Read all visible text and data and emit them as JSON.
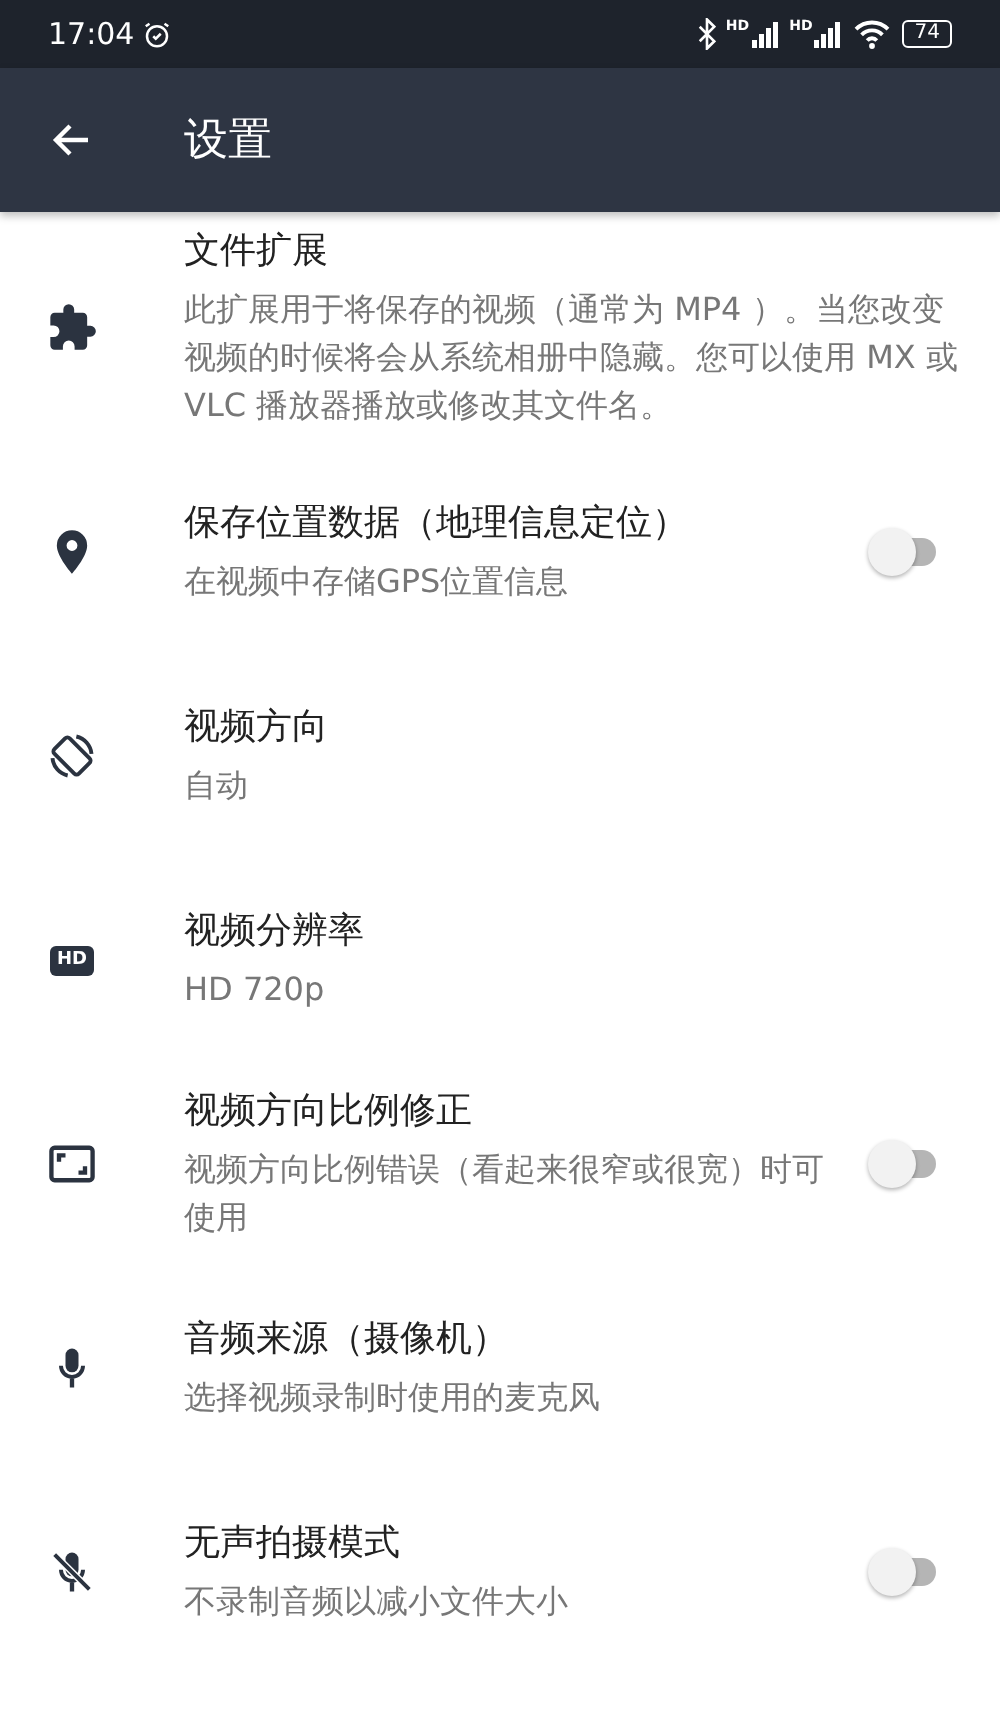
{
  "status_bar": {
    "time": "17:04",
    "network_labels": [
      "HD",
      "HD"
    ],
    "battery": "74"
  },
  "app_bar": {
    "title": "设置"
  },
  "settings": [
    {
      "kind": "plain",
      "title": "文件扩展",
      "description": "此扩展用于将保存的视频（通常为 MP4 ）。当您改变视频的时候将会从系统相册中隐藏。您可以使用 MX 或 VLC 播放器播放或修改其文件名。"
    },
    {
      "kind": "toggle",
      "title": "保存位置数据（地理信息定位）",
      "description": "在视频中存储GPS位置信息",
      "on": false
    },
    {
      "kind": "plain",
      "title": "视频方向",
      "description": "自动"
    },
    {
      "kind": "plain",
      "title": "视频分辨率",
      "description": "HD 720p",
      "icon_label": "HD"
    },
    {
      "kind": "toggle",
      "title": "视频方向比例修正",
      "description": "视频方向比例错误（看起来很窄或很宽）时可使用",
      "on": false
    },
    {
      "kind": "plain",
      "title": "音频来源（摄像机）",
      "description": "选择视频录制时使用的麦克风"
    },
    {
      "kind": "toggle",
      "title": "无声拍摄模式",
      "description": "不录制音频以减小文件大小",
      "on": false
    }
  ]
}
